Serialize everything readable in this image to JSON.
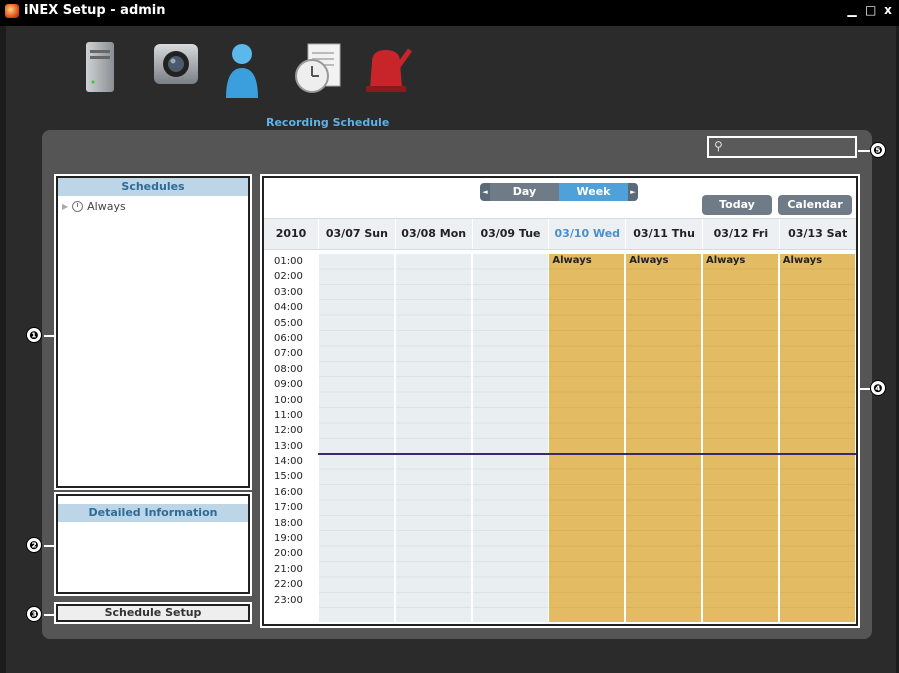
{
  "window": {
    "title": "iNEX Setup - admin",
    "minimize": "▁",
    "maximize": "□",
    "close": "x"
  },
  "toolbar": {
    "items": [
      {
        "icon": "server-icon",
        "label": ""
      },
      {
        "icon": "camera-icon",
        "label": ""
      },
      {
        "icon": "user-icon",
        "label": ""
      },
      {
        "icon": "recording-schedule-icon",
        "label": "Recording Schedule"
      },
      {
        "icon": "alarm-siren-icon",
        "label": ""
      }
    ]
  },
  "search": {
    "placeholder": ""
  },
  "schedules": {
    "header": "Schedules",
    "items": [
      {
        "label": "Always"
      }
    ]
  },
  "detail": {
    "header": "Detailed Information"
  },
  "setup_button": "Schedule Setup",
  "calendar": {
    "view_day": "Day",
    "view_week": "Week",
    "view_left_arrow": "◄",
    "view_right_arrow": "►",
    "today": "Today",
    "calendar": "Calendar",
    "year": "2010",
    "days": [
      {
        "label": "03/07 Sun",
        "today": false,
        "event": ""
      },
      {
        "label": "03/08 Mon",
        "today": false,
        "event": ""
      },
      {
        "label": "03/09 Tue",
        "today": false,
        "event": ""
      },
      {
        "label": "03/10 Wed",
        "today": true,
        "event": "Always"
      },
      {
        "label": "03/11 Thu",
        "today": false,
        "event": "Always"
      },
      {
        "label": "03/12 Fri",
        "today": false,
        "event": "Always"
      },
      {
        "label": "03/13 Sat",
        "today": false,
        "event": "Always"
      }
    ],
    "hours": [
      "01:00",
      "02:00",
      "03:00",
      "04:00",
      "05:00",
      "06:00",
      "07:00",
      "08:00",
      "09:00",
      "10:00",
      "11:00",
      "12:00",
      "13:00",
      "14:00",
      "15:00",
      "16:00",
      "17:00",
      "18:00",
      "19:00",
      "20:00",
      "21:00",
      "22:00",
      "23:00"
    ]
  },
  "callouts": [
    "❶",
    "❷",
    "❸",
    "❹",
    "❺"
  ],
  "colors": {
    "accent_blue": "#4ea1d9",
    "event_fill": "#e3bb62",
    "header_blue": "#bcd6e8",
    "now_line": "#3b2a6e"
  }
}
